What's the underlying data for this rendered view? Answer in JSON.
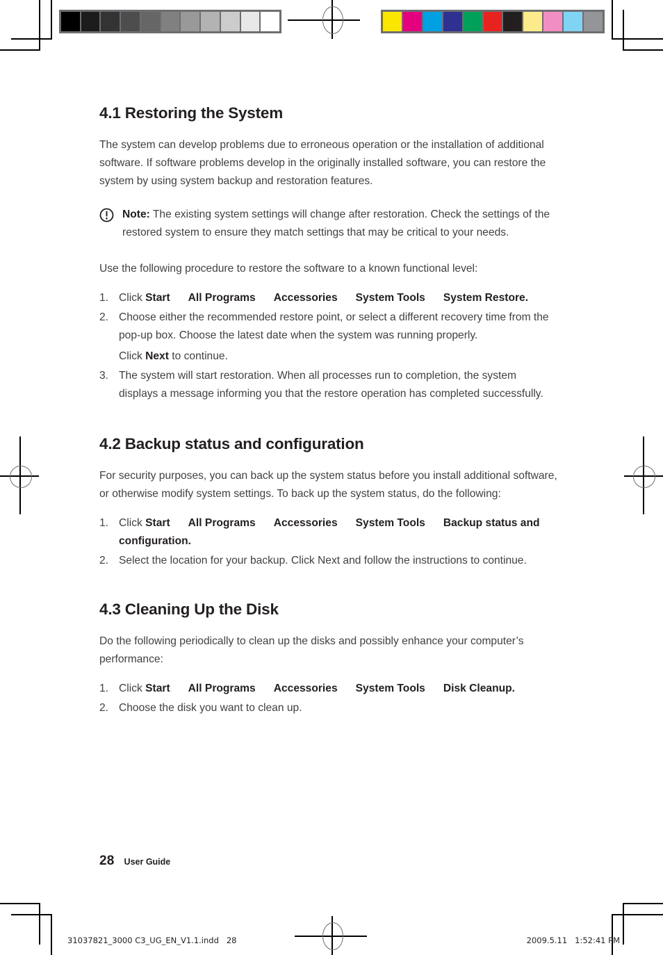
{
  "page": {
    "number": "28",
    "guide_label": "User Guide"
  },
  "calibration": {
    "grayscale_label": "grayscale-calibration-bar",
    "grayscale": [
      "#000000",
      "#1c1c1c",
      "#333333",
      "#4d4d4d",
      "#666666",
      "#808080",
      "#999999",
      "#b3b3b3",
      "#cccccc",
      "#e8e8e8",
      "#ffffff"
    ],
    "color_label": "color-calibration-bar",
    "colors": [
      "#fbe600",
      "#e5007e",
      "#00a0e2",
      "#2e3192",
      "#00a05a",
      "#e8231f",
      "#231f20",
      "#fbeb8a",
      "#f18fc4",
      "#7fd4f4",
      "#939598"
    ]
  },
  "sections": [
    {
      "heading": "4.1 Restoring the System",
      "intro": "The system can develop problems due to erroneous operation or the installation of additional software. If software problems develop in the originally installed software, you can restore the system by using system backup and restoration features.",
      "note": {
        "lead": "Note:",
        "text": " The existing system settings will change after restoration. Check the settings of the restored system to ensure they match settings that may be critical to your needs."
      },
      "lead_in": "Use the following procedure to restore the software to a known functional level:",
      "steps": [
        {
          "num": "1.",
          "prefix": "Click ",
          "path": [
            "Start",
            "All Programs",
            "Accessories",
            "System Tools",
            "System Restore"
          ],
          "suffix": "."
        },
        {
          "num": "2.",
          "text": "Choose either the recommended restore point, or select a different recovery time from the pop-up box. Choose the latest date when the system was running properly.",
          "sub_prefix": "Click ",
          "sub_bold": "Next",
          "sub_suffix": " to continue."
        },
        {
          "num": "3.",
          "text": "The system will start restoration. When all processes run to completion, the system displays a message informing you that the restore operation has completed successfully."
        }
      ]
    },
    {
      "heading": "4.2 Backup status and configuration",
      "intro": "For security purposes, you can back up the system status before you install additional software, or otherwise modify system settings. To back up the system status, do the following:",
      "steps": [
        {
          "num": "1.",
          "prefix": "Click ",
          "path": [
            "Start",
            "All Programs",
            "Accessories",
            "System Tools",
            "Backup status and configuration."
          ],
          "suffix": ""
        },
        {
          "num": "2.",
          "text": "Select the location for your backup. Click Next and follow the instructions to continue."
        }
      ]
    },
    {
      "heading": "4.3 Cleaning Up the Disk",
      "intro": "Do the following periodically to clean up the disks and possibly enhance your computer’s performance:",
      "steps": [
        {
          "num": "1.",
          "prefix": "Click ",
          "path": [
            "Start",
            "All Programs",
            "Accessories",
            "System Tools",
            "Disk Cleanup"
          ],
          "suffix": "."
        },
        {
          "num": "2.",
          "text": "Choose the disk you want to clean up."
        }
      ]
    }
  ],
  "slug": {
    "left": "31037821_3000 C3_UG_EN_V1.1.indd   28",
    "right": "2009.5.11   1:52:41 PM"
  }
}
